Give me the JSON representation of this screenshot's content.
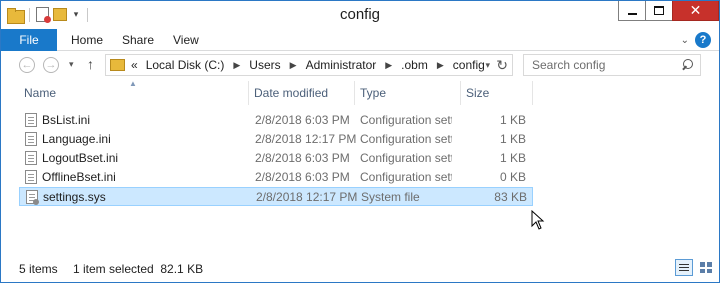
{
  "window": {
    "title": "config"
  },
  "ribbon": {
    "file_label": "File",
    "tabs": [
      "Home",
      "Share",
      "View"
    ],
    "help_label": "?"
  },
  "address": {
    "overflow": "«",
    "crumbs": [
      "Local Disk (C:)",
      "Users",
      "Administrator",
      ".obm",
      "config"
    ]
  },
  "search": {
    "placeholder": "Search config"
  },
  "columns": [
    "Name",
    "Date modified",
    "Type",
    "Size"
  ],
  "files": [
    {
      "name": "BsList.ini",
      "date": "2/8/2018 6:03 PM",
      "type": "Configuration sett...",
      "size": "1 KB",
      "selected": false
    },
    {
      "name": "Language.ini",
      "date": "2/8/2018 12:17 PM",
      "type": "Configuration sett...",
      "size": "1 KB",
      "selected": false
    },
    {
      "name": "LogoutBset.ini",
      "date": "2/8/2018 6:03 PM",
      "type": "Configuration sett...",
      "size": "1 KB",
      "selected": false
    },
    {
      "name": "OfflineBset.ini",
      "date": "2/8/2018 6:03 PM",
      "type": "Configuration sett...",
      "size": "0 KB",
      "selected": false
    },
    {
      "name": "settings.sys",
      "date": "2/8/2018 12:17 PM",
      "type": "System file",
      "size": "83 KB",
      "selected": true
    }
  ],
  "status": {
    "item_count": "5 items",
    "selection": "1 item selected  82.1 KB"
  },
  "colors": {
    "accent": "#1979ca",
    "selection": "#cce8ff",
    "close": "#c7312b"
  }
}
